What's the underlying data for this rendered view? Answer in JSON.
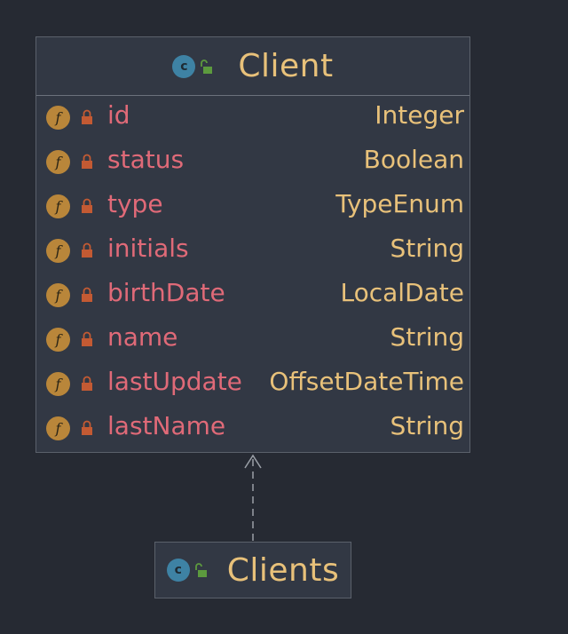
{
  "classes": {
    "client": {
      "name": "Client",
      "class_icon_letter": "c",
      "fields": [
        {
          "name": "id",
          "type": "Integer"
        },
        {
          "name": "status",
          "type": "Boolean"
        },
        {
          "name": "type",
          "type": "TypeEnum"
        },
        {
          "name": "initials",
          "type": "String"
        },
        {
          "name": "birthDate",
          "type": "LocalDate"
        },
        {
          "name": "name",
          "type": "String"
        },
        {
          "name": "lastUpdate",
          "type": "OffsetDateTime"
        },
        {
          "name": "lastName",
          "type": "String"
        }
      ]
    },
    "clients": {
      "name": "Clients",
      "class_icon_letter": "c"
    }
  },
  "field_icon_letter": "f",
  "relation": {
    "type": "dependency",
    "from": "Clients",
    "to": "Client"
  },
  "colors": {
    "background": "#262a33",
    "box": "#323844",
    "class_name": "#e8c17a",
    "field_name": "#e06a78",
    "field_type": "#e8c17a",
    "class_icon": "#3e82a4",
    "field_icon": "#b9863a",
    "private_lock": "#c35a33",
    "public_lock": "#5c9a3e"
  },
  "icons": {
    "class": "class-c-icon",
    "public": "unlocked-padlock-icon",
    "field": "field-f-icon",
    "private": "locked-padlock-icon"
  }
}
